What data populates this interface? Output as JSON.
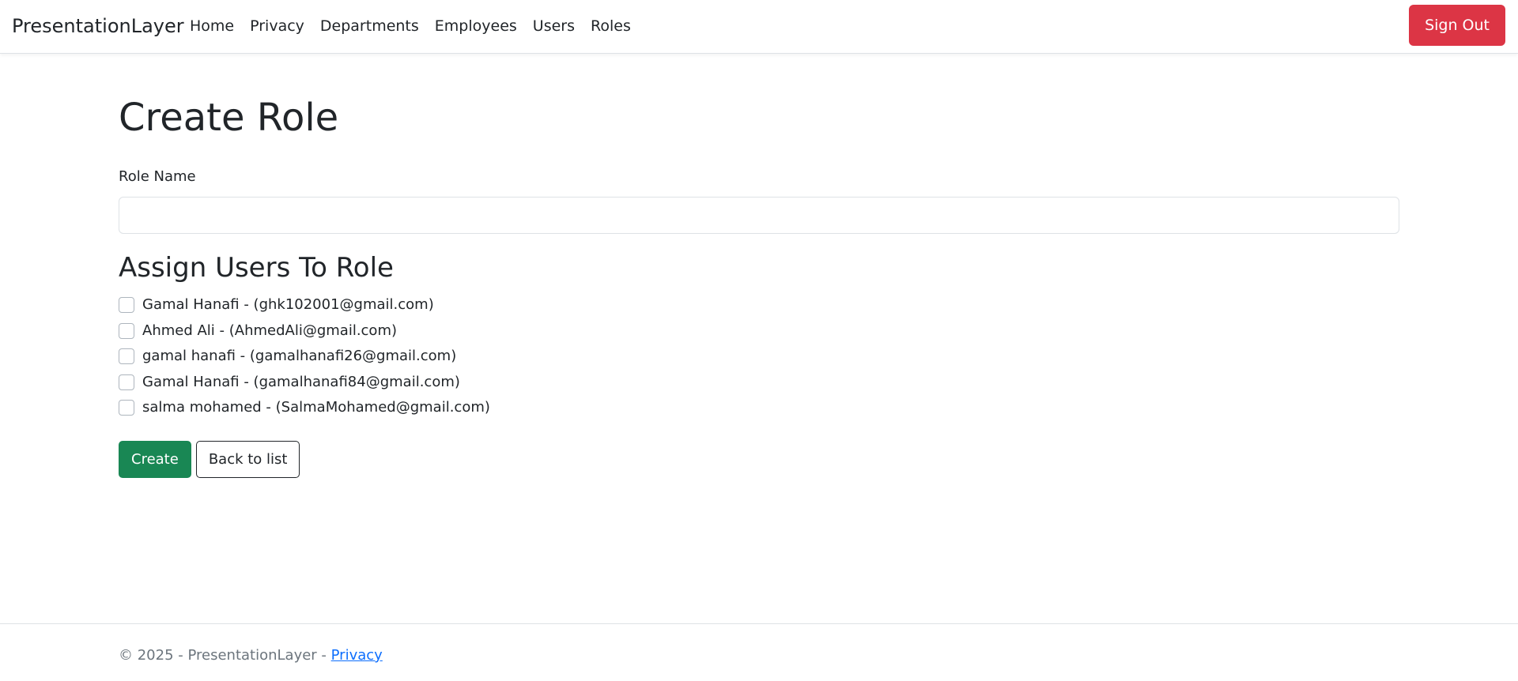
{
  "navbar": {
    "brand": "PresentationLayer",
    "links": [
      "Home",
      "Privacy",
      "Departments",
      "Employees",
      "Users",
      "Roles"
    ],
    "sign_out": "Sign Out"
  },
  "page": {
    "title": "Create Role"
  },
  "form": {
    "role_name_label": "Role Name",
    "role_name_value": "",
    "assign_title": "Assign Users To Role",
    "users": [
      "Gamal Hanafi - (ghk102001@gmail.com)",
      "Ahmed Ali - (AhmedAli@gmail.com)",
      "gamal hanafi - (gamalhanafi26@gmail.com)",
      "Gamal Hanafi - (gamalhanafi84@gmail.com)",
      "salma mohamed - (SalmaMohamed@gmail.com)"
    ],
    "create_label": "Create",
    "back_label": "Back to list"
  },
  "footer": {
    "text": "© 2025 - PresentationLayer - ",
    "privacy_link": "Privacy"
  },
  "colors": {
    "sign_out": "#dc3545",
    "create": "#198754",
    "link": "#0d6efd",
    "footer_text": "#6c757d"
  }
}
